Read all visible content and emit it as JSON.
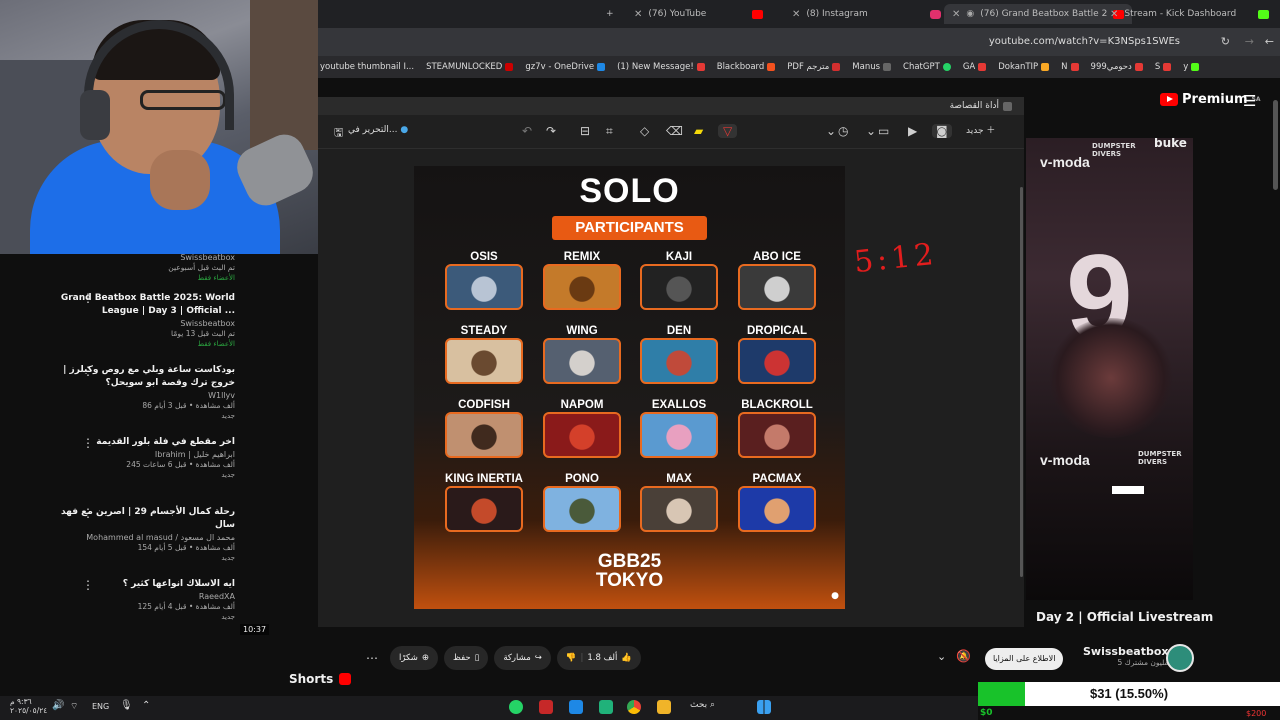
{
  "browser": {
    "tabs": [
      {
        "label": "(76) YouTube",
        "color": "#ff0000"
      },
      {
        "label": "(8) Instagram",
        "color": "#e1306c"
      },
      {
        "label": "(76) Grand Beatbox Battle 2",
        "color": "#ff0000"
      },
      {
        "label": "Stream - Kick Dashboard",
        "color": "#53fc18"
      }
    ],
    "new_tab": "+",
    "url": "youtube.com/watch?v=K3NSps1SWEs",
    "bookmarks": [
      "youtube thumbnail I...",
      "STEAMUNLOCKED",
      "gz7v - OneDrive",
      "(1) New Message!",
      "Blackboard",
      "PDF مترجم",
      "Manus",
      "ChatGPT",
      "GA",
      "DokanTIP",
      "N",
      "999دحومي",
      "S",
      "y"
    ]
  },
  "youtube": {
    "premium_label": "Premium",
    "premium_region": "SA",
    "live_title": "Day 2 | Official Livestream",
    "channel_name": "Swissbeatbox",
    "subscribers": "5 مليون مشترك",
    "join_label": "الاطلاع على المزايا",
    "like_count": "1.8 ألف",
    "share_label": "مشاركة",
    "save_label": "حفظ",
    "thanks_label": "شكرًا",
    "shorts_label": "Shorts",
    "time_stamp": "10:37",
    "related": [
      {
        "title": "",
        "channel": "Swissbeatbox",
        "meta": "تم البث قبل أسبوعين",
        "badge": "الأعضاء فقط"
      },
      {
        "title": "Grand Beatbox Battle 2025: World League | Day 3 | Official ...",
        "channel": "Swissbeatbox",
        "meta": "تم البث قبل 13 يومًا",
        "badge": "الأعضاء فقط"
      },
      {
        "title": "بودكاست ساعة وبلي مع روص وكيلرز | خروج ترك وقصة ابو سويحل؟",
        "channel": "W1llyv",
        "meta": "86 ألف مشاهدة • قبل 3 أيام",
        "badge": "جديد"
      },
      {
        "title": "اخر مقطع في فلة بلور القديمة",
        "channel": "Ibrahim | ابراهيم خليل",
        "meta": "245 ألف مشاهدة • قبل 6 ساعات",
        "badge": "جديد"
      },
      {
        "title": "رحلة كمال الأجسام 29 | اصرين مع فهد سال",
        "channel": "Mohammed al masud / محمد ال مسعود",
        "meta": "154 ألف مشاهدة • قبل 5 أيام",
        "badge": "جديد"
      },
      {
        "title": "ايه الاسلاك انواعها كثير ؟",
        "channel": "RaeedXA",
        "meta": "125 ألف مشاهدة • قبل 4 أيام",
        "badge": "جديد"
      }
    ]
  },
  "snipping": {
    "title": "أداة القصاصة",
    "edit_label": "التحرير في...",
    "new_label": "جديد",
    "annotation": "5:12"
  },
  "poster": {
    "title": "SOLO",
    "subtitle": "PARTICIPANTS",
    "logo_line1": "GBB25",
    "logo_line2": "TOKYO",
    "participants": [
      "OSIS",
      "REMIX",
      "KAJI",
      "ABO ICE",
      "STEADY",
      "WING",
      "DEN",
      "DROPICAL",
      "CODFISH",
      "NAPOM",
      "EXALLOS",
      "BLACKROLL",
      "KING INERTIA",
      "PONO",
      "MAX",
      "PACMAX"
    ]
  },
  "right_video": {
    "big_number": "9",
    "brand": "v-moda",
    "brand2": "DUMPSTER DIVERS"
  },
  "donation": {
    "text": "$31 (15.50%)",
    "progress": 0.155,
    "min": "$0",
    "max": "$200"
  },
  "taskbar": {
    "time": "٩:٣٦ م",
    "date": "٢٠٢٥/٠٥/٢٤",
    "lang": "ENG",
    "search_label": "بحث"
  },
  "colors": {
    "accent": "#e85a13",
    "youtube_red": "#ff0000",
    "donation_green": "#18c22a"
  }
}
